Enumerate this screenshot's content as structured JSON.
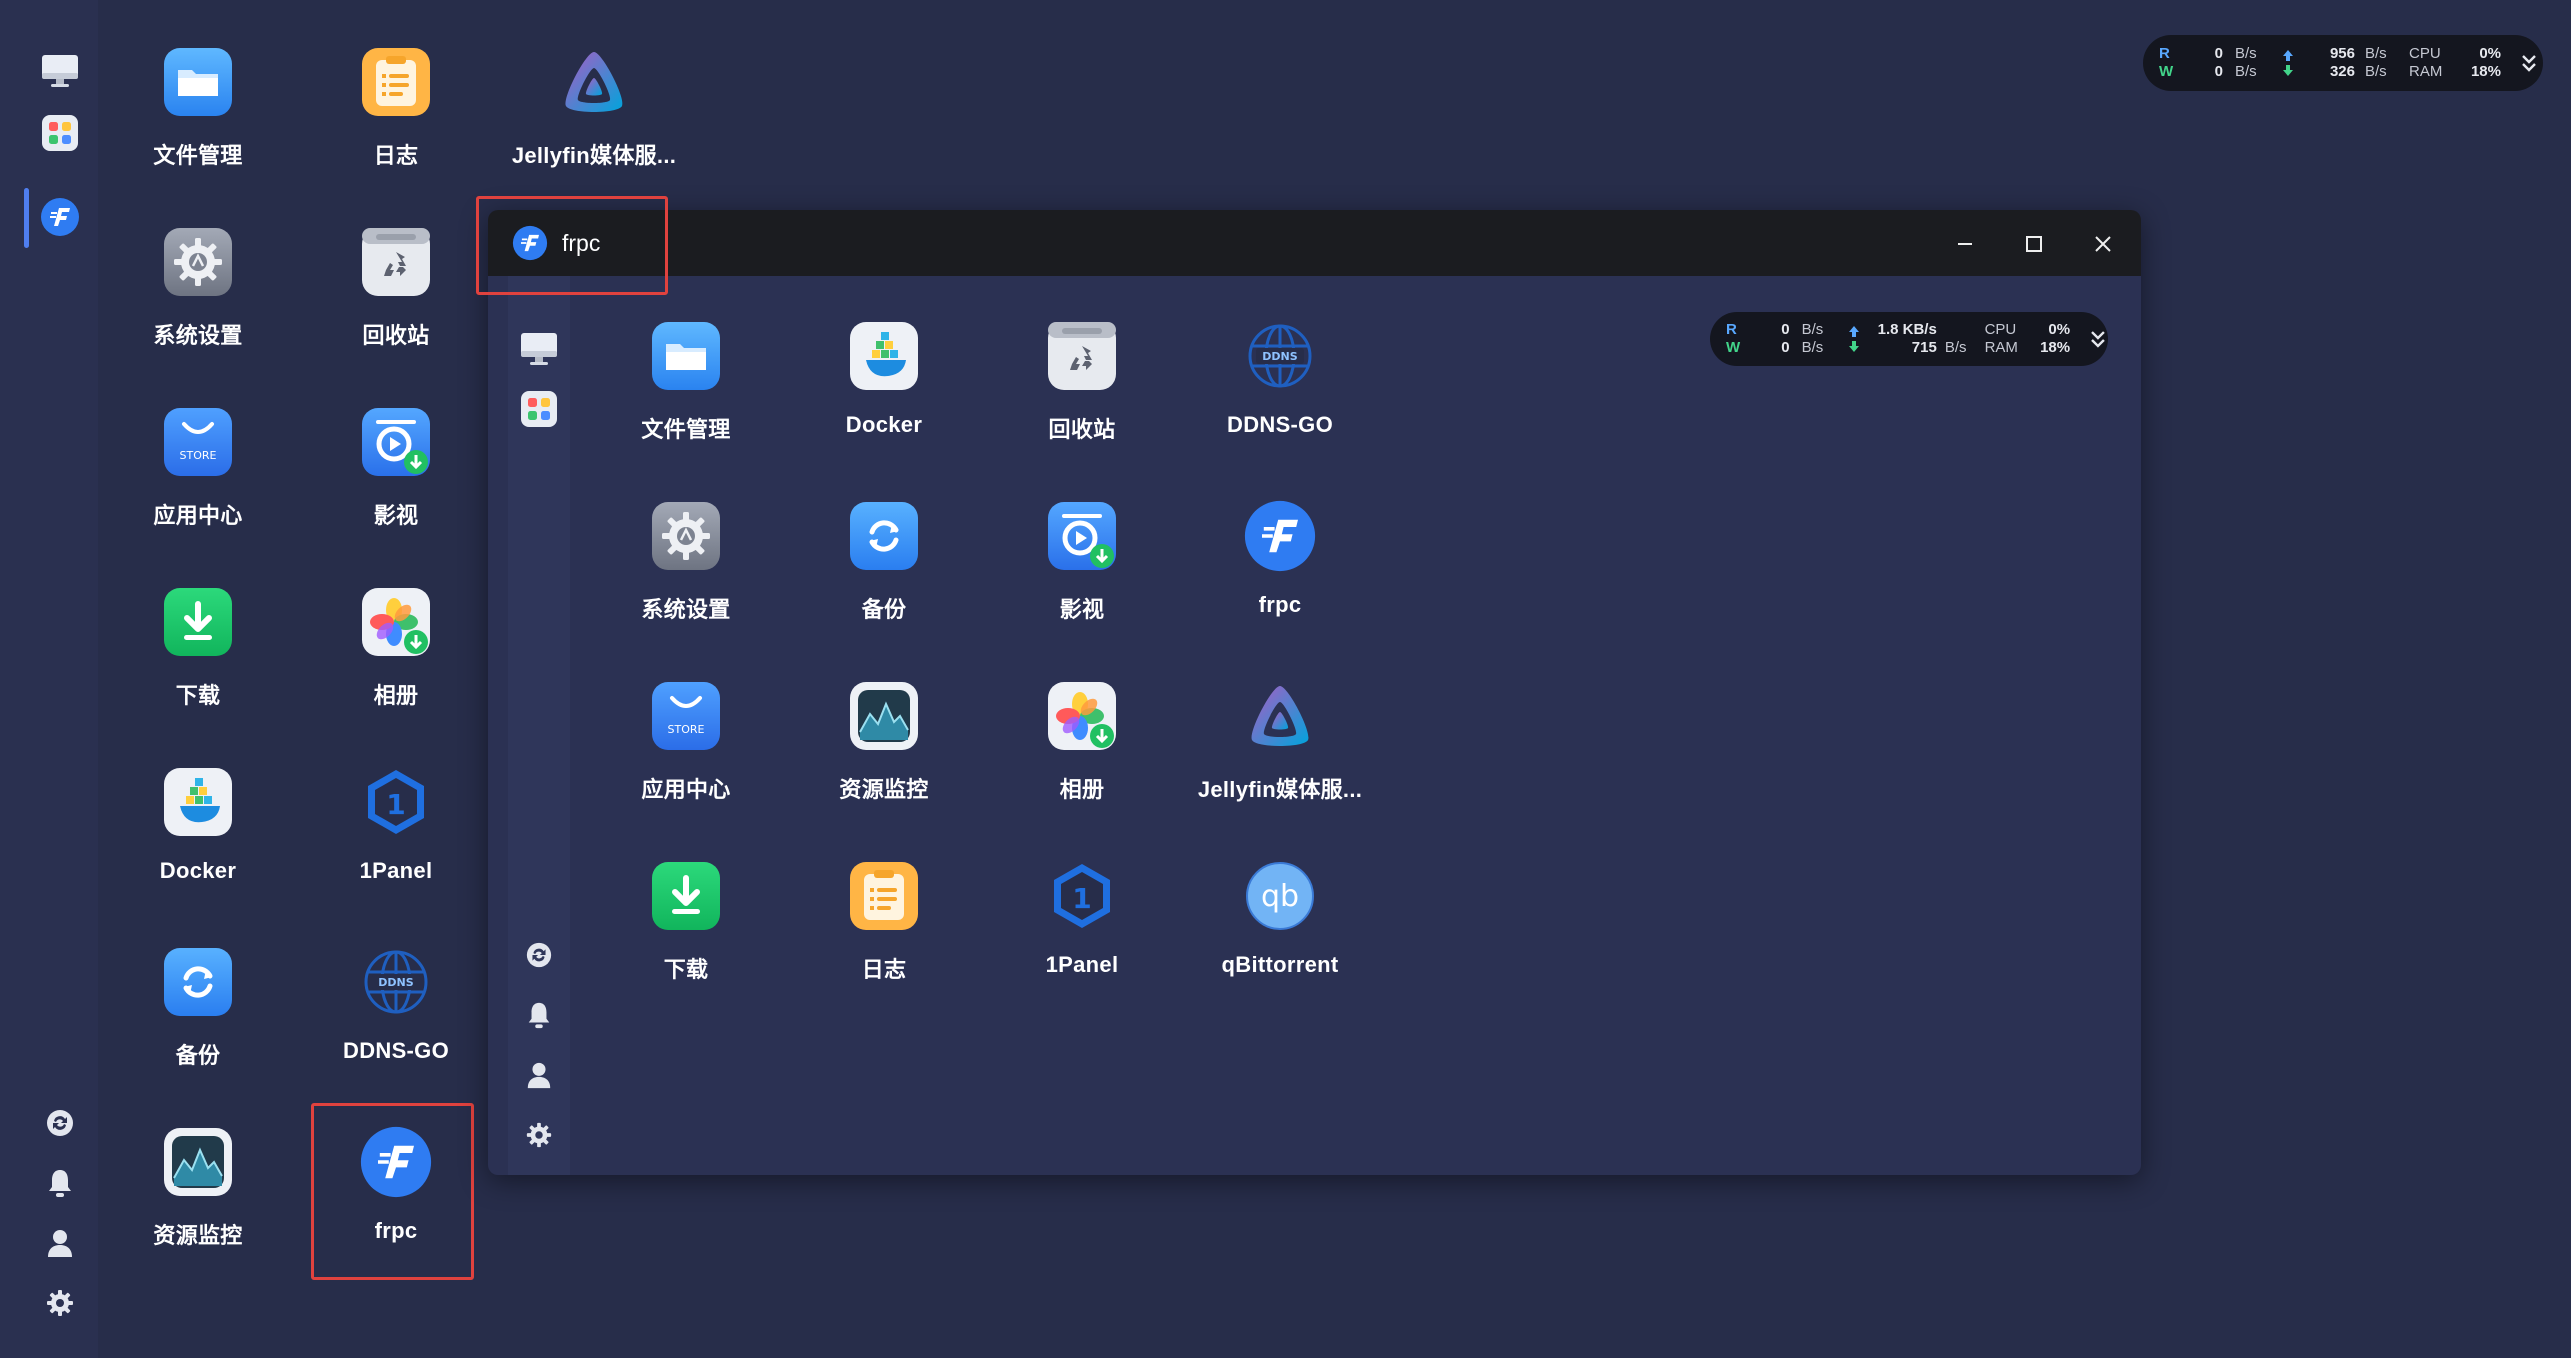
{
  "desktop_apps": [
    {
      "id": "filemanager",
      "label": "文件管理"
    },
    {
      "id": "logs",
      "label": "日志"
    },
    {
      "id": "jellyfin",
      "label": "Jellyfin媒体服..."
    },
    {
      "id": "settings",
      "label": "系统设置"
    },
    {
      "id": "recycle",
      "label": "回收站"
    },
    {
      "id": "store",
      "label": "应用中心"
    },
    {
      "id": "video",
      "label": "影视"
    },
    {
      "id": "download",
      "label": "下载"
    },
    {
      "id": "album",
      "label": "相册"
    },
    {
      "id": "docker",
      "label": "Docker"
    },
    {
      "id": "onepanel",
      "label": "1Panel"
    },
    {
      "id": "backup",
      "label": "备份"
    },
    {
      "id": "ddnsgo",
      "label": "DDNS-GO"
    },
    {
      "id": "monitor",
      "label": "资源监控"
    },
    {
      "id": "frpc",
      "label": "frpc"
    }
  ],
  "desktop_monitor": {
    "r_label": "R",
    "w_label": "W",
    "r_disk": "0",
    "w_disk": "0",
    "disk_unit": "B/s",
    "up_value": "956",
    "down_value": "326",
    "net_unit": "B/s",
    "cpu_label": "CPU",
    "ram_label": "RAM",
    "cpu_value": "0%",
    "ram_value": "18%"
  },
  "window": {
    "title": "frpc",
    "apps": [
      {
        "id": "filemanager",
        "label": "文件管理"
      },
      {
        "id": "docker",
        "label": "Docker"
      },
      {
        "id": "recycle",
        "label": "回收站"
      },
      {
        "id": "ddnsgo",
        "label": "DDNS-GO"
      },
      {
        "id": "settings",
        "label": "系统设置"
      },
      {
        "id": "backup",
        "label": "备份"
      },
      {
        "id": "video",
        "label": "影视"
      },
      {
        "id": "frpc",
        "label": "frpc"
      },
      {
        "id": "store",
        "label": "应用中心"
      },
      {
        "id": "monitor",
        "label": "资源监控"
      },
      {
        "id": "album",
        "label": "相册"
      },
      {
        "id": "jellyfin",
        "label": "Jellyfin媒体服..."
      },
      {
        "id": "download",
        "label": "下载"
      },
      {
        "id": "logs",
        "label": "日志"
      },
      {
        "id": "onepanel",
        "label": "1Panel"
      },
      {
        "id": "qbittorrent",
        "label": "qBittorrent"
      }
    ],
    "monitor": {
      "r_label": "R",
      "w_label": "W",
      "r_disk": "0",
      "w_disk": "0",
      "disk_unit": "B/s",
      "up_value": "1.8 KB/s",
      "down_value": "715",
      "down_unit": "B/s",
      "cpu_label": "CPU",
      "ram_label": "RAM",
      "cpu_value": "0%",
      "ram_value": "18%"
    }
  },
  "icon_text": {
    "store_badge": "STORE",
    "ddns_badge": "DDNS",
    "onepanel_badge": "1",
    "qb_badge": "qb"
  },
  "colors": {
    "background": "#272d4a",
    "titlebar": "#1b1c20",
    "highlight": "#e0423e",
    "accent_blue": "#3a7bf0"
  }
}
